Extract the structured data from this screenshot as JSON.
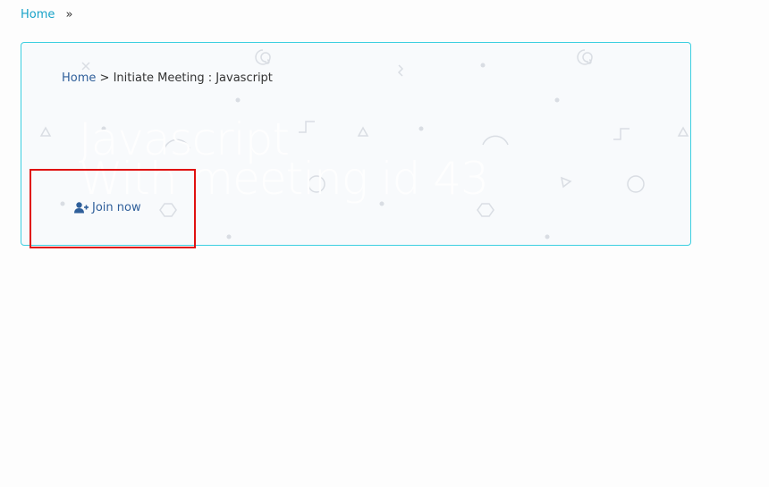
{
  "top_breadcrumb": {
    "home_label": "Home",
    "separator": "»"
  },
  "banner": {
    "breadcrumb": {
      "home_label": "Home",
      "separator": ">",
      "current": "Initiate Meeting : Javascript"
    },
    "title_line1": "Javascript",
    "title_line2": "With meeting id 43",
    "join_label": "Join now",
    "join_icon": "user-plus-icon"
  },
  "colors": {
    "link_top": "#17a2c8",
    "link_inner": "#2f5f9a",
    "banner_border": "#3ccfe0",
    "highlight": "#e01010"
  }
}
